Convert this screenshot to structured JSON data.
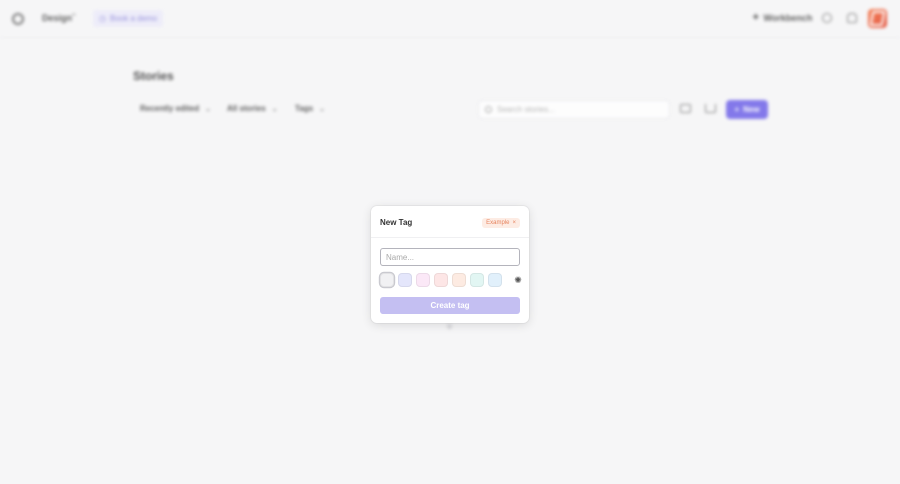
{
  "topbar": {
    "workspace_label": "Design",
    "demo_label": "Book a demo",
    "workbench_label": "Workbench"
  },
  "page": {
    "title": "Stories",
    "filters": [
      {
        "label": "Recently edited"
      },
      {
        "label": "All stories"
      },
      {
        "label": "Tags"
      }
    ],
    "search_placeholder": "Search stories...",
    "new_label": "New"
  },
  "modal": {
    "title": "New Tag",
    "badge_label": "Example",
    "name_placeholder": "Name...",
    "create_label": "Create tag",
    "swatch_colors": [
      "#f1f1f3",
      "#e4e6fb",
      "#fbe8f7",
      "#fde6e6",
      "#fdebe2",
      "#e2f6f3",
      "#e1f0fb"
    ],
    "selected_swatch": 0
  },
  "icons": {
    "sidebar_toggle": "sidebar-icon",
    "workspace_chevron": "chevron-icon",
    "demo": "calendar-icon",
    "workbench": "sparkle-icon",
    "search": "search-icon",
    "notifications": "bell-icon",
    "view_toggle": "folder-icon",
    "download": "download-icon",
    "new": "plus-icon",
    "badge_close": "close-icon",
    "custom_color": "palette-icon"
  },
  "colors": {
    "accent": "#6f63e8",
    "accent_disabled": "#c4bff2",
    "brand": "#e9532f",
    "badge_bg": "#fdece4",
    "badge_text": "#e7835e"
  }
}
